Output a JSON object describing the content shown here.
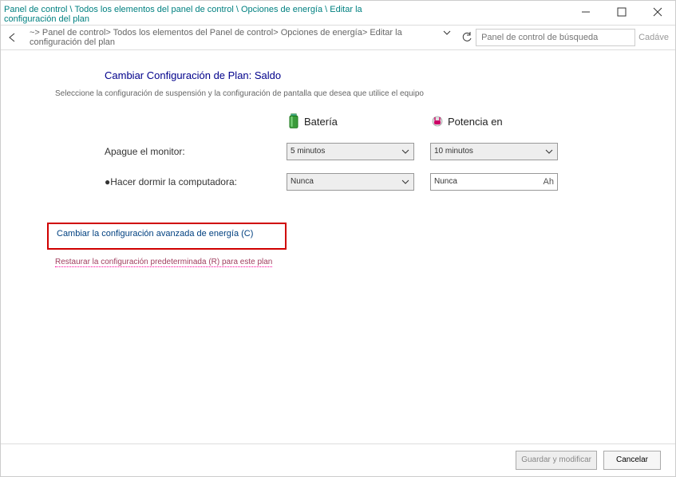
{
  "window": {
    "title_path": "Panel de control \\ Todos los elementos del panel de control \\ Opciones de energía \\ Editar la configuración del plan"
  },
  "navbar": {
    "breadcrumb": "~> Panel de control> Todos los elementos del Panel de control> Opciones de energía> Editar la configuración del plan",
    "search_placeholder": "Panel de control de búsqueda",
    "edge_text": "Cadáve"
  },
  "page": {
    "title": "Cambiar Configuración de Plan: Saldo",
    "subtitle": "Seleccione la configuración de suspensión y la configuración de pantalla que desea que utilice el equipo"
  },
  "columns": {
    "battery": "Batería",
    "plugged": "Potencia en"
  },
  "rows": {
    "display_off": {
      "label": "Apague el monitor:",
      "battery_value": "5 minutos",
      "plugged_value": "10 minutos"
    },
    "sleep": {
      "label": "Hacer dormir la computadora:",
      "battery_value": "Nunca",
      "plugged_value": "Nunca",
      "plugged_tail": "Ah"
    }
  },
  "links": {
    "advanced": "Cambiar la configuración avanzada de energía (C)",
    "restore": "Restaurar la configuración predeterminada (R) para este plan"
  },
  "buttons": {
    "save": "Guardar y modificar",
    "cancel": "Cancelar"
  }
}
